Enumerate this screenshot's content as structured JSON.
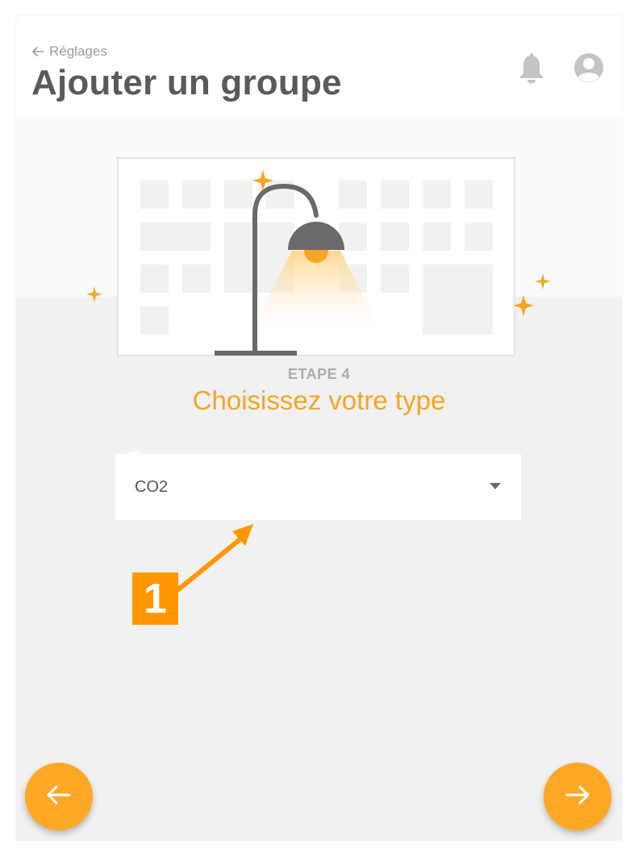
{
  "header": {
    "back_label": "Réglages",
    "title": "Ajouter un groupe",
    "icons": [
      "arrow-left-icon",
      "bell-icon",
      "user-avatar-icon"
    ]
  },
  "step": {
    "label": "ETAPE 4",
    "title": "Choisissez votre type"
  },
  "type_select": {
    "value": "CO2"
  },
  "annotation": {
    "number": "1"
  },
  "navigation": {
    "prev_icon": "arrow-left-icon",
    "next_icon": "arrow-right-icon"
  },
  "colors": {
    "accent": "#f5a623",
    "fab": "#ffa825",
    "annotation": "#ff9800",
    "title_text": "#5a5a5a",
    "background": "#f1f1f1"
  }
}
